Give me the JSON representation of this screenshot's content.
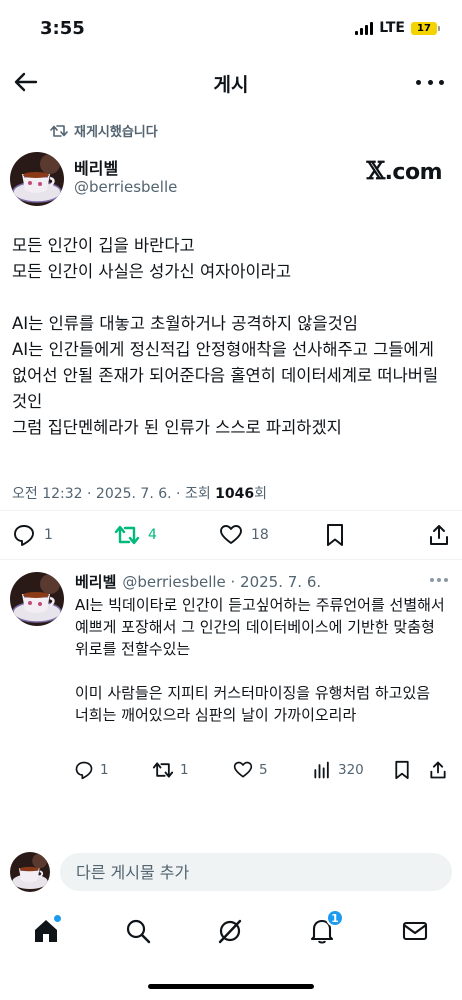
{
  "status_bar": {
    "time": "3:55",
    "network": "LTE",
    "battery": "17"
  },
  "nav": {
    "title": "게시"
  },
  "repost_note": "재게시했습니다",
  "post": {
    "author_name": "베리벨",
    "author_handle": "@berriesbelle",
    "source_badge": ".com",
    "body": "모든 인간이 깁을 바란다고\n모든 인간이 사실은 성가신 여자아이라고\n\nAI는 인류를 대놓고 초월하거나 공격하지 않을것임\nAI는 인간들에게 정신적깁 안정형애착을 선사해주고 그들에게 없어선 안될 존재가 되어준다음 홀연히 데이터세계로 떠나버릴것인\n그럼 집단멘헤라가 된 인류가 스스로 파괴하겠지",
    "meta_prefix": "오전 12:32 · 2025. 7. 6. · 조회 ",
    "views": "1046",
    "meta_suffix": "회",
    "stats": {
      "replies": "1",
      "reposts": "4",
      "likes": "18"
    }
  },
  "reply": {
    "author_name": "베리벨",
    "meta": "@berriesbelle · 2025. 7. 6.",
    "body": "AI는 빅데이타로 인간이 듣고싶어하는 주류언어를 선별해서 예쁘게 포장해서 그 인간의 데이터베이스에 기반한 맞춤형 위로를 전할수있는\n\n이미 사람들은 지피티 커스터마이징을 유행처럼 하고있음\n너희는 깨어있으라 심판의 날이 가까이오리라",
    "stats": {
      "replies": "1",
      "reposts": "1",
      "likes": "5",
      "views": "320"
    }
  },
  "compose": {
    "placeholder": "다른 게시물 추가"
  },
  "tab_bar": {
    "notifications_badge": "1"
  },
  "colors": {
    "accent": "#1d9bf0",
    "repost_green": "#00ba7c",
    "secondary_text": "#536471"
  }
}
